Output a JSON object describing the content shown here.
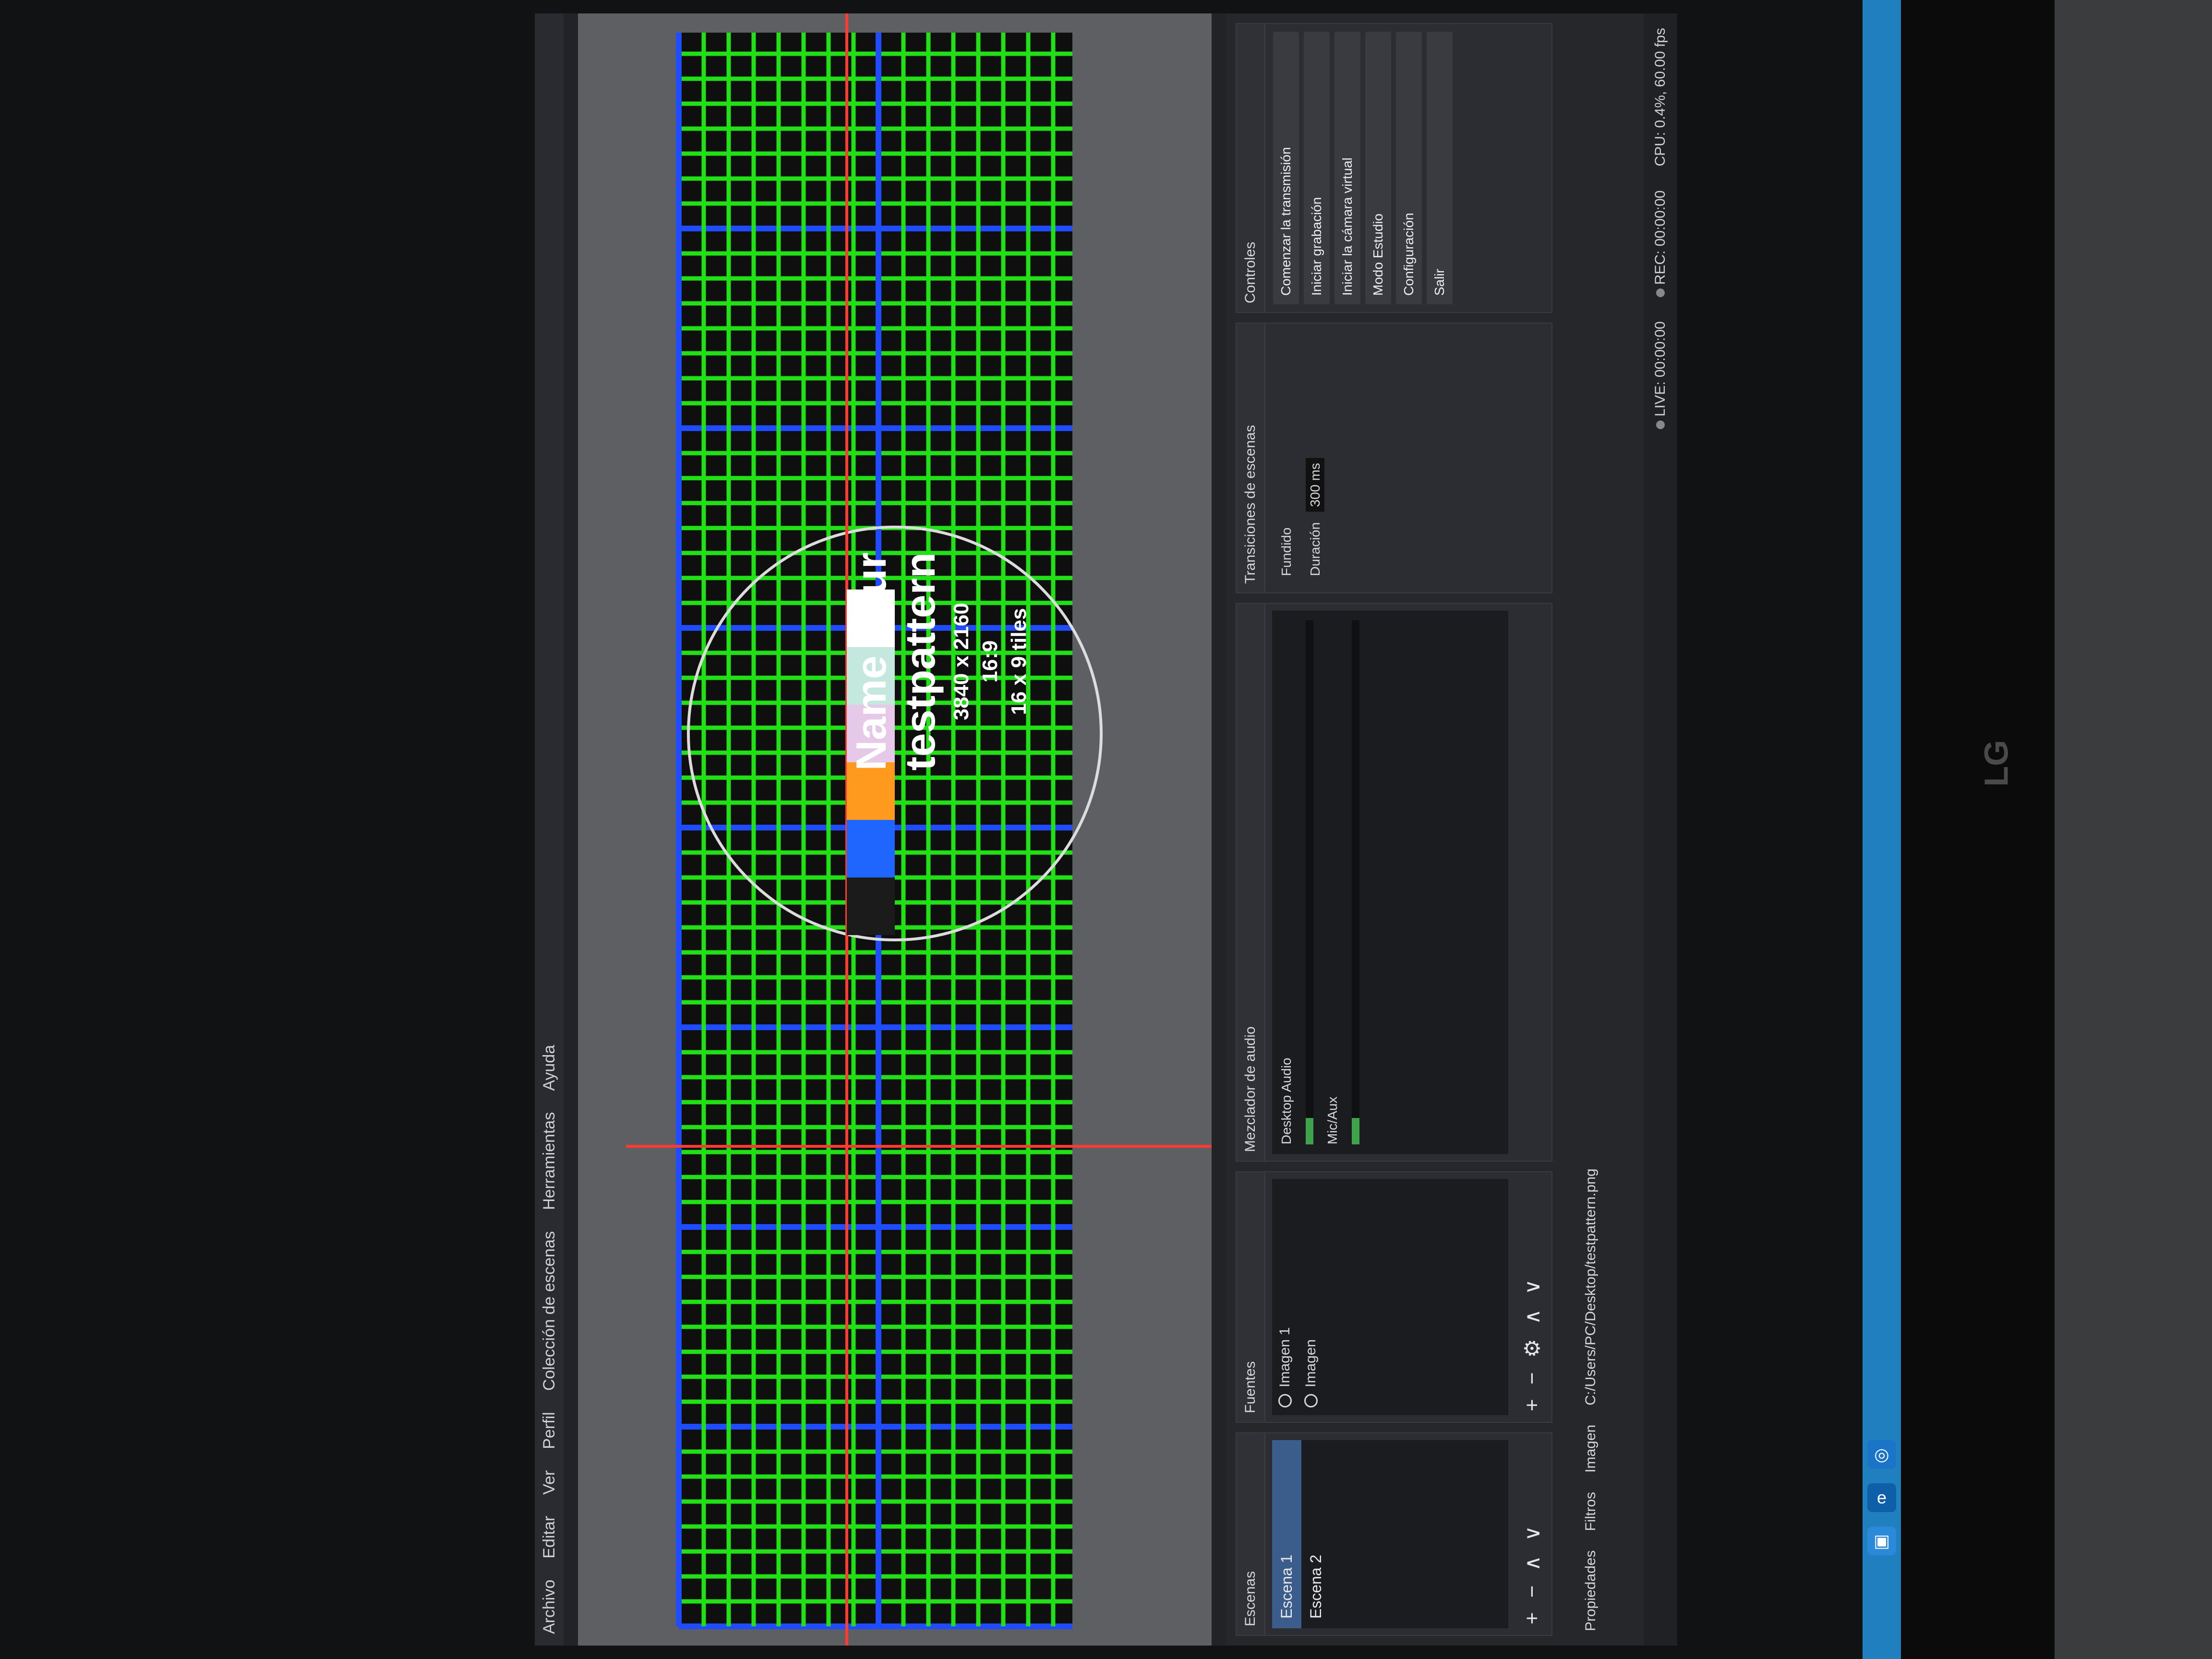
{
  "menu": {
    "items": [
      "Archivo",
      "Editar",
      "Ver",
      "Perfil",
      "Colección de escenas",
      "Herramientas",
      "Ayuda"
    ]
  },
  "preview": {
    "pattern_title": "Name your testpattern",
    "pattern_line1": "3840 x 2160",
    "pattern_line2": "16:9",
    "pattern_line3": "16 x 9 tiles"
  },
  "docks": {
    "scenes": {
      "title": "Escenas",
      "items": [
        "Escena 1",
        "Escena 2"
      ],
      "selected": 0
    },
    "sources": {
      "title": "Fuentes",
      "items": [
        "Imagen 1",
        "Imagen"
      ]
    },
    "mixer": {
      "title": "Mezclador de audio",
      "rows": [
        "Desktop Audio",
        "Mic/Aux"
      ],
      "level": 0.05
    },
    "transitions": {
      "title": "Transiciones de escenas",
      "type": "Fundido",
      "duration_label": "Duración",
      "duration_value": "300 ms"
    },
    "controls": {
      "title": "Controles",
      "buttons": [
        "Comenzar la transmisión",
        "Iniciar grabación",
        "Iniciar la cámara virtual",
        "Modo Estudio",
        "Configuración",
        "Salir"
      ]
    }
  },
  "footer": {
    "path": "C:/Users/PC/Desktop/testpattern.png",
    "properties": "Propiedades",
    "filters": "Filtros",
    "imagen": "Imagen"
  },
  "status": {
    "live": "LIVE: 00:00:00",
    "rec": "REC: 00:00:00",
    "cpu": "CPU: 0.4%, 60.00 fps"
  },
  "colors": {
    "grid": "#22e016",
    "grid_accent": "#1f4cff",
    "guide": "#ff3b2f",
    "taskbar": "#1f7fbf"
  },
  "swatches": [
    "#1b1b1b",
    "#1f66ff",
    "#ff9a1f",
    "#e6c9e8",
    "#c4e8dd",
    "#ffffff"
  ]
}
